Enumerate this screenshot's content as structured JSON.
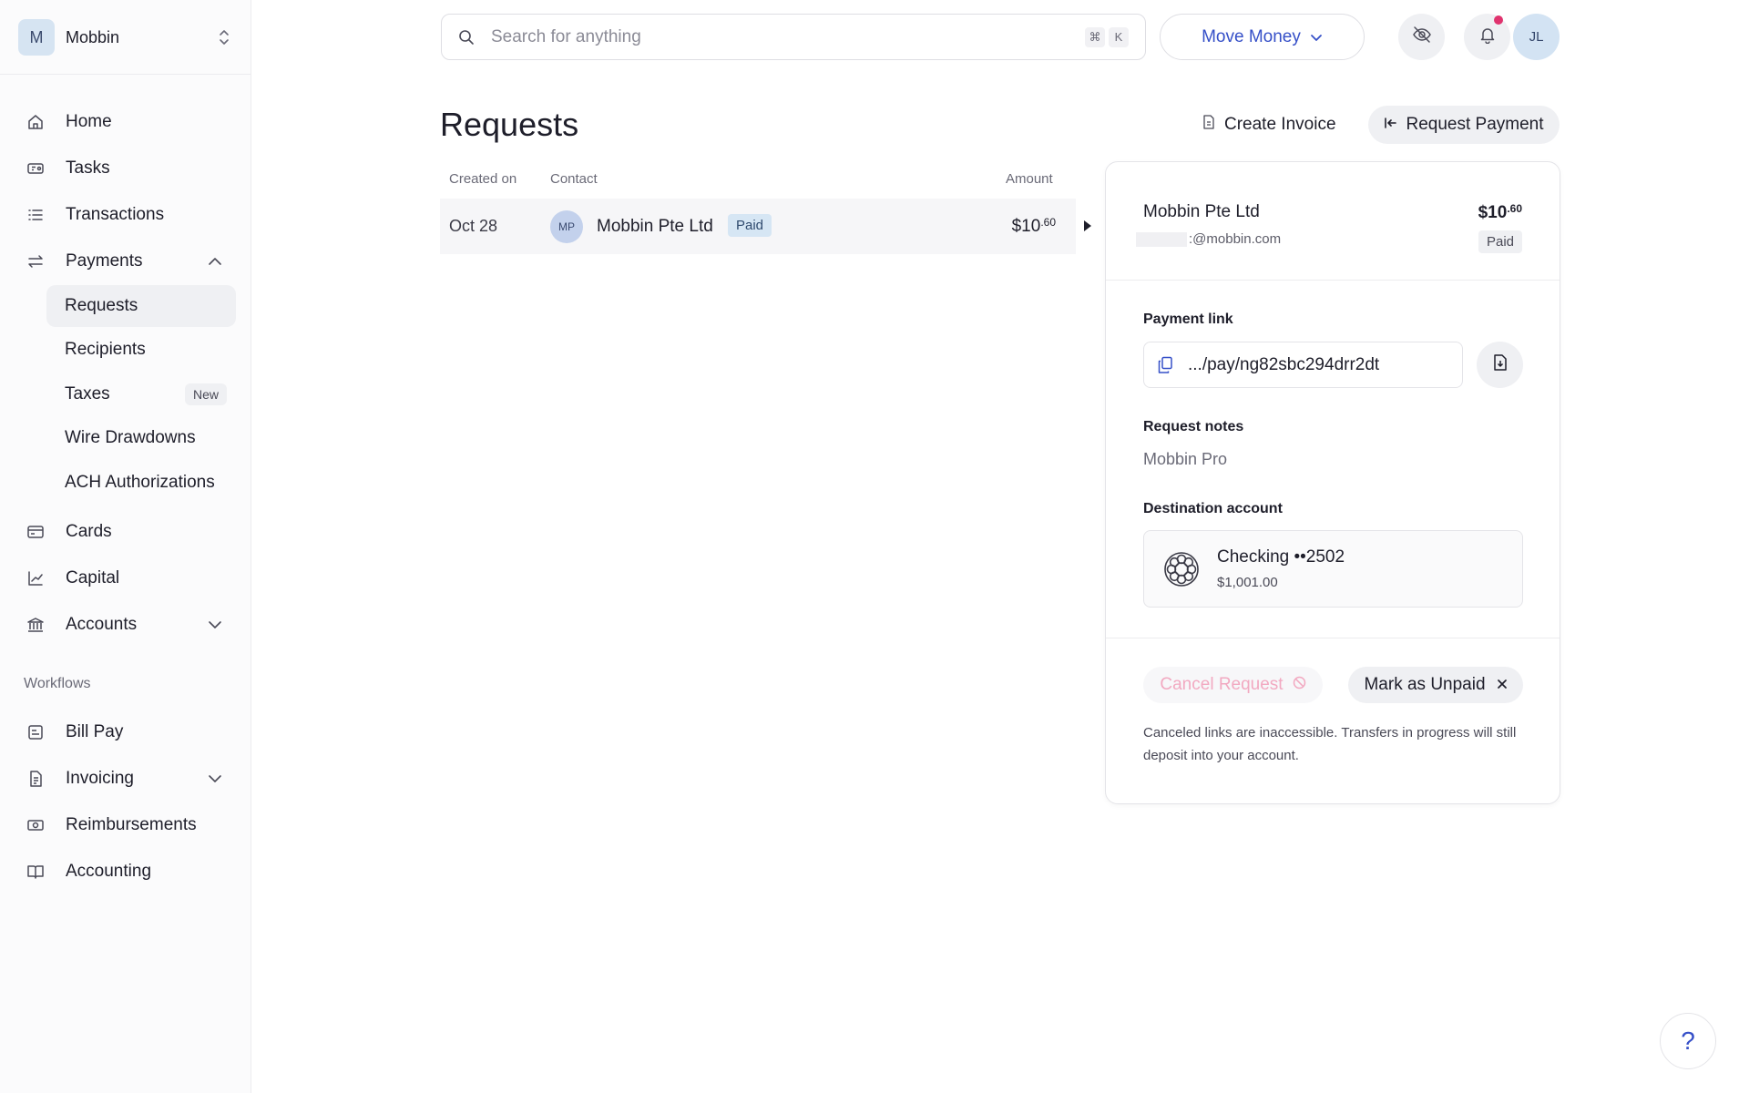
{
  "org": {
    "initial": "M",
    "name": "Mobbin"
  },
  "sidebar": {
    "items": [
      {
        "label": "Home",
        "icon": "home-icon"
      },
      {
        "label": "Tasks",
        "icon": "tasks-icon"
      },
      {
        "label": "Transactions",
        "icon": "list-icon"
      },
      {
        "label": "Payments",
        "icon": "transfer-icon",
        "expanded": true
      },
      {
        "label": "Cards",
        "icon": "card-icon"
      },
      {
        "label": "Capital",
        "icon": "chart-icon"
      },
      {
        "label": "Accounts",
        "icon": "bank-icon"
      }
    ],
    "payments_sub": [
      {
        "label": "Requests",
        "active": true
      },
      {
        "label": "Recipients"
      },
      {
        "label": "Taxes",
        "badge": "New"
      },
      {
        "label": "Wire Drawdowns"
      },
      {
        "label": "ACH Authorizations"
      }
    ],
    "section_label": "Workflows",
    "workflows": [
      {
        "label": "Bill Pay",
        "icon": "bill-icon"
      },
      {
        "label": "Invoicing",
        "icon": "invoice-icon"
      },
      {
        "label": "Reimbursements",
        "icon": "cash-icon"
      },
      {
        "label": "Accounting",
        "icon": "book-icon"
      }
    ]
  },
  "topbar": {
    "search_placeholder": "Search for anything",
    "shortcut": [
      "⌘",
      "K"
    ],
    "move_money_label": "Move Money",
    "user_initials": "JL"
  },
  "main": {
    "title": "Requests",
    "create_invoice_label": "Create Invoice",
    "request_payment_label": "Request Payment",
    "columns": {
      "created": "Created on",
      "contact": "Contact",
      "amount": "Amount"
    },
    "rows": [
      {
        "date": "Oct 28",
        "initials": "MP",
        "contact": "Mobbin Pte Ltd",
        "status": "Paid",
        "amount_main": "$10",
        "amount_cents": ".60"
      }
    ]
  },
  "detail": {
    "name": "Mobbin Pte Ltd",
    "email_visible": ":@mobbin.com",
    "amount_main": "$10",
    "amount_cents": ".60",
    "status": "Paid",
    "payment_link_label": "Payment link",
    "payment_link": ".../pay/ng82sbc294drr2dt",
    "notes_label": "Request notes",
    "notes_value": "Mobbin Pro",
    "destination_label": "Destination account",
    "account_name": "Checking ••2502",
    "account_balance": "$1,001.00",
    "cancel_label": "Cancel Request",
    "unpaid_label": "Mark as Unpaid",
    "footnote": "Canceled links are inaccessible. Transfers in progress will still deposit into your account."
  },
  "help_label": "?",
  "colors": {
    "accent": "#3650c8",
    "notification": "#e0336e",
    "paid_badge": "#d6e6f4",
    "cancel_text": "#f2a9c1"
  }
}
